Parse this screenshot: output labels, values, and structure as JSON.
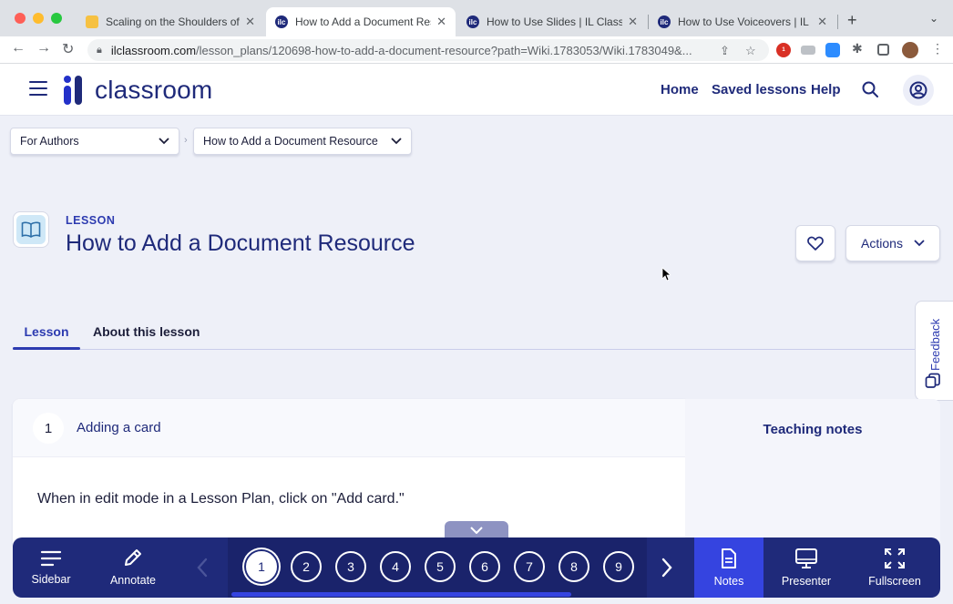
{
  "browser": {
    "tabs": [
      {
        "title": "Scaling on the Shoulders of Pa",
        "favicon": "document-favicon",
        "active": false
      },
      {
        "title": "How to Add a Document Resou",
        "favicon": "ilc-favicon",
        "active": true
      },
      {
        "title": "How to Use Slides | IL Classroo",
        "favicon": "ilc-favicon",
        "active": false
      },
      {
        "title": "How to Use Voiceovers | IL Cla",
        "favicon": "ilc-favicon",
        "active": false
      }
    ],
    "favicon_text": "ilc",
    "new_tab": "+",
    "url_domain": "ilclassroom.com",
    "url_path": "/lesson_plans/120698-how-to-add-a-document-resource?path=Wiki.1783053/Wiki.1783049&...",
    "ext_badge": "1"
  },
  "header": {
    "logo_text": "classroom",
    "nav": [
      "Home",
      "Saved lessons",
      "Help"
    ]
  },
  "breadcrumb": {
    "first": "For Authors",
    "second": "How to Add a Document Resource"
  },
  "lesson": {
    "kicker": "LESSON",
    "title": "How to Add a Document Resource",
    "actions_label": "Actions"
  },
  "tabs": {
    "lesson": "Lesson",
    "about": "About this lesson"
  },
  "feedback_label": "Feedback",
  "card": {
    "number": "1",
    "title": "Adding a card",
    "body": "When in edit mode in a Lesson Plan, click on \"Add card.\""
  },
  "teaching_notes": "Teaching notes",
  "toolbar": {
    "sidebar": "Sidebar",
    "annotate": "Annotate",
    "slides": [
      "1",
      "2",
      "3",
      "4",
      "5",
      "6",
      "7",
      "8",
      "9"
    ],
    "active_slide": "1",
    "progress_fraction": 0.81,
    "notes": "Notes",
    "presenter": "Presenter",
    "fullscreen": "Fullscreen"
  },
  "colors": {
    "brand_navy": "#1f2a7a",
    "brand_blue": "#2d3bb0",
    "accent": "#3544e0",
    "page_bg": "#eef0f8"
  }
}
